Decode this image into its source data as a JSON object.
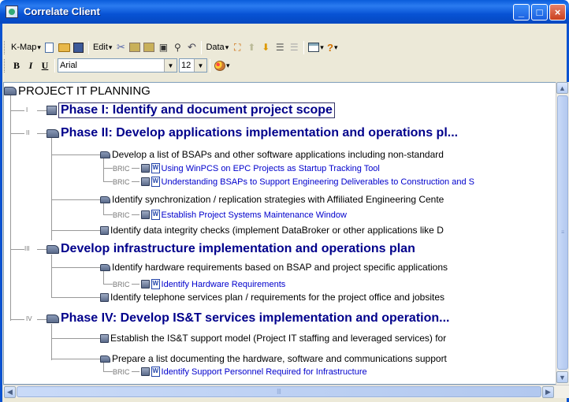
{
  "window": {
    "title": "Correlate Client"
  },
  "toolbar": {
    "kmap_label": "K-Map",
    "edit_label": "Edit",
    "data_label": "Data",
    "bold_label": "B",
    "italic_label": "I",
    "underline_label": "U",
    "font_value": "Arial",
    "size_value": "12"
  },
  "tree": {
    "root": "PROJECT IT PLANNING",
    "phases": [
      {
        "num": "I",
        "title": "Phase I: Identify and document project scope"
      },
      {
        "num": "II",
        "title": "Phase II: Develop applications implementation and operations pl...",
        "items": [
          {
            "text": "Develop a list of BSAPs and other software applications including non-standard",
            "links": [
              "Using WinPCS on EPC Projects as Startup Tracking Tool",
              "Understanding BSAPs to Support Engineering Deliverables to Construction and S"
            ]
          },
          {
            "text": "Identify synchronization / replication strategies with Affiliated Engineering Cente",
            "links": [
              "Establish Project Systems Maintenance Window"
            ]
          },
          {
            "text": "Identify data integrity checks (implement DataBroker or other applications like D",
            "links": []
          }
        ]
      },
      {
        "num": "III",
        "title": "Develop infrastructure implementation and operations plan",
        "items": [
          {
            "text": "Identify hardware requirements based on BSAP and project specific applications",
            "links": [
              "Identify Hardware Requirements"
            ]
          },
          {
            "text": "Identify telephone services plan / requirements for the project office and jobsites",
            "links": []
          }
        ]
      },
      {
        "num": "IV",
        "title": "Phase IV: Develop IS&T services implementation and operation...",
        "items": [
          {
            "text": "Establish the IS&T support model (Project IT staffing and leveraged services) for",
            "links": []
          },
          {
            "text": "Prepare a list documenting the hardware, software and communications support",
            "links": [
              "Identify Support Personnel Required for Infrastructure"
            ]
          }
        ]
      }
    ],
    "link_prefix": "BRIC"
  }
}
